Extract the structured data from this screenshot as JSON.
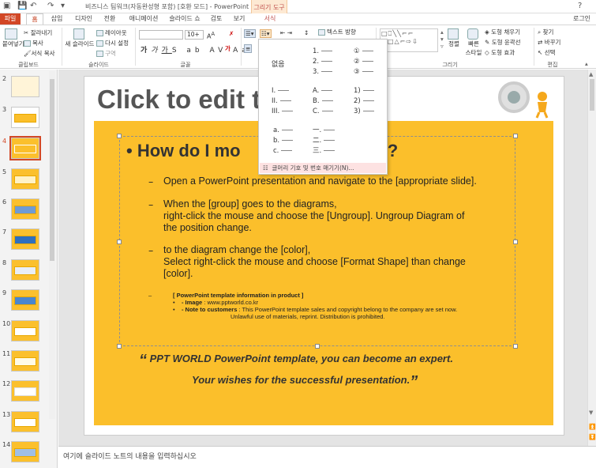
{
  "window": {
    "title": "비즈니스 팀워크(자동완성형 포함) [호환 모드] - PowerPoint",
    "context_group": "그리기 도구",
    "user": "로그인"
  },
  "tabs": [
    "파일",
    "홈",
    "삽입",
    "디자인",
    "전환",
    "애니메이션",
    "슬라이드 쇼",
    "검토",
    "보기",
    "서식"
  ],
  "ribbon": {
    "clipboard": {
      "paste": "붙여넣기",
      "cut": "잘라내기",
      "copy": "복사",
      "format_painter": "서식 복사",
      "label": "클립보드"
    },
    "slides": {
      "new_slide": "새 슬라이드",
      "layout": "레이아웃",
      "reset": "다시 설정",
      "section": "구역",
      "label": "슬라이드"
    },
    "font": {
      "size": "10+",
      "label": "글꼴"
    },
    "paragraph": {
      "text_direction": "텍스트 방향"
    },
    "drawing": {
      "arrange": "정렬",
      "quick_styles": "빠른 스타일",
      "fill": "도형 채우기",
      "outline": "도형 윤곽선",
      "effects": "도형 효과",
      "label": "그리기"
    },
    "editing": {
      "find": "찾기",
      "replace": "바꾸기",
      "select": "선택",
      "label": "편집"
    }
  },
  "numbering_menu": {
    "none": "없음",
    "col1": [
      "1.",
      "2.",
      "3."
    ],
    "col2": [
      "①",
      "②",
      "③"
    ],
    "row2a": [
      "I.",
      "II.",
      "III."
    ],
    "row2b": [
      "A.",
      "B.",
      "C."
    ],
    "row2c": [
      "1)",
      "2)",
      "3)"
    ],
    "row3a": [
      "a.",
      "b.",
      "c."
    ],
    "row3b": [
      "一.",
      "二.",
      "三."
    ],
    "footer": "글머리 기호 및 번호 매기기(N)..."
  },
  "thumbnails": [
    "2",
    "3",
    "4",
    "5",
    "6",
    "7",
    "8",
    "9",
    "10",
    "11",
    "12",
    "13",
    "14"
  ],
  "slide": {
    "title": "Click to edit t",
    "bullet": "How do I mo",
    "bullet_tail": "l?",
    "sub1": "Open a PowerPoint presentation and navigate to the [appropriate slide].",
    "sub2a": "When the [group] goes to the diagrams,",
    "sub2b": "right-click the mouse and choose the [Ungroup]. Ungroup Diagram of",
    "sub2c": "the position change.",
    "sub3a": "to the diagram change the [color],",
    "sub3b": "Select right-click the mouse and choose [Format Shape] than change",
    "sub3c": "[color].",
    "info_title": "[ PowerPoint template information in product ]",
    "info_image_label": "- Image",
    "info_image": " : www.pptworld.co.kr",
    "info_note_label": "- Note to customers",
    "info_note": " : This PowerPoint template sales and copyright belong to the company are set now.",
    "info_note2": "Unlawful use of materials, reprint. Distribution is prohibited.",
    "quote1": "PPT WORLD PowerPoint template, you can become an expert.",
    "quote2": "Your wishes for the successful presentation."
  },
  "notes_placeholder": "여기에 슬라이드 노트의 내용을 입력하십시오",
  "colors": {
    "file_tab": "#d24726",
    "slide_yellow": "#fbbf2b",
    "context": "#fde9d3"
  }
}
